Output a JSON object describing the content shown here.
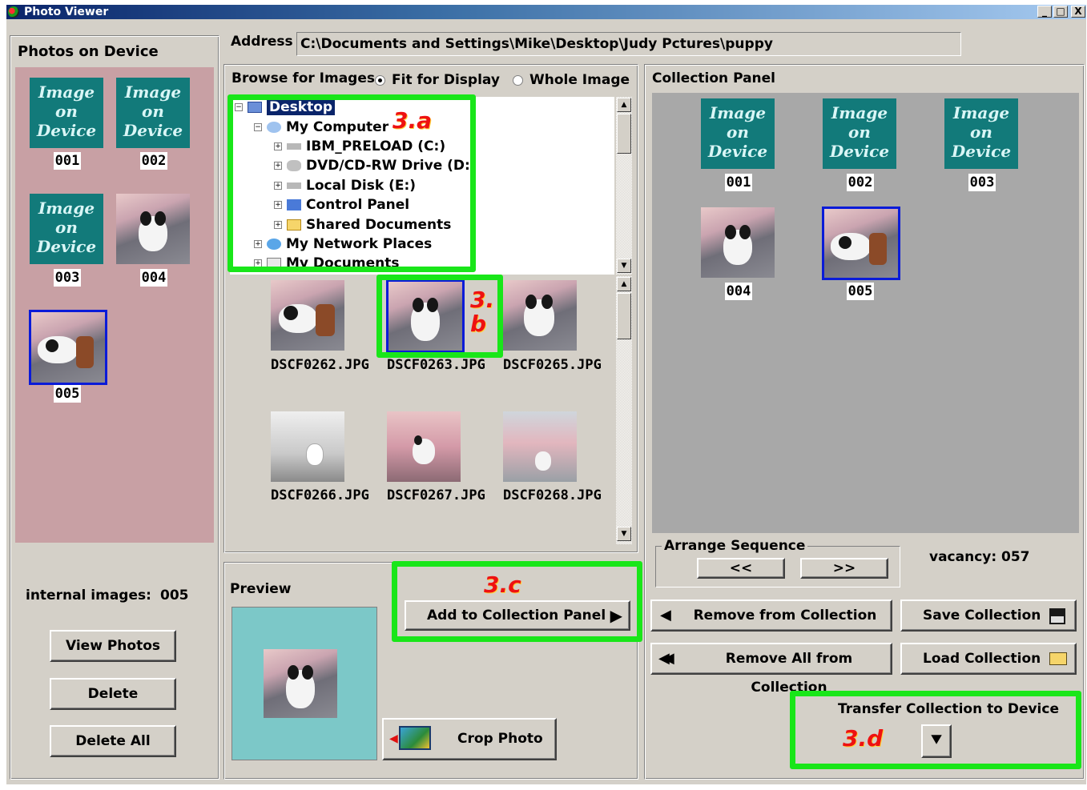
{
  "window": {
    "title": "Photo Viewer",
    "controls": [
      "_",
      "□",
      "X"
    ]
  },
  "device_panel": {
    "title": "Photos on Device",
    "placeholder_lines": [
      "Image",
      "on",
      "Device"
    ],
    "items": [
      {
        "number": "001",
        "type": "placeholder"
      },
      {
        "number": "002",
        "type": "placeholder"
      },
      {
        "number": "003",
        "type": "placeholder"
      },
      {
        "number": "004",
        "type": "photo"
      },
      {
        "number": "005",
        "type": "photo",
        "selected": true
      }
    ],
    "internal_label": "internal images:",
    "internal_count": "005",
    "buttons": {
      "view": "View Photos",
      "delete": "Delete",
      "delete_all": "Delete All"
    }
  },
  "address": {
    "label": "Address",
    "value": "C:\\Documents and Settings\\Mike\\Desktop\\Judy Pctures\\puppy"
  },
  "browse": {
    "label": "Browse for Images",
    "options": [
      {
        "label": "Fit for Display",
        "checked": true
      },
      {
        "label": "Whole Image",
        "checked": false
      }
    ],
    "tree": [
      {
        "label": "Desktop",
        "icon": "desktop-icon",
        "selected": true
      },
      {
        "label": "My Computer",
        "icon": "computer-icon"
      },
      {
        "label": "IBM_PRELOAD (C:)",
        "icon": "drive-icon"
      },
      {
        "label": "DVD/CD-RW Drive (D:)",
        "icon": "cd-drive-icon"
      },
      {
        "label": "Local Disk (E:)",
        "icon": "drive-icon"
      },
      {
        "label": "Control Panel",
        "icon": "control-panel-icon"
      },
      {
        "label": "Shared Documents",
        "icon": "folder-icon"
      },
      {
        "label": "My Network Places",
        "icon": "network-icon"
      },
      {
        "label": "My Documents",
        "icon": "documents-icon"
      }
    ],
    "files": [
      "DSCF0262.JPG",
      "DSCF0263.JPG",
      "DSCF0265.JPG",
      "DSCF0266.JPG",
      "DSCF0267.JPG",
      "DSCF0268.JPG"
    ],
    "selected_file": "DSCF0263.JPG"
  },
  "annotations": {
    "a": "3.a",
    "b1": "3.",
    "b2": "b",
    "c": "3.c",
    "d": "3.d"
  },
  "preview": {
    "label": "Preview"
  },
  "add_button": "Add to Collection Panel",
  "crop_button": "Crop Photo",
  "collection": {
    "title": "Collection Panel",
    "placeholder_lines": [
      "Image",
      "on",
      "Device"
    ],
    "items": [
      {
        "number": "001",
        "type": "placeholder"
      },
      {
        "number": "002",
        "type": "placeholder"
      },
      {
        "number": "003",
        "type": "placeholder"
      },
      {
        "number": "004",
        "type": "photo"
      },
      {
        "number": "005",
        "type": "photo",
        "selected": true
      }
    ],
    "arrange_label": "Arrange Sequence",
    "arrange_prev": "<<",
    "arrange_next": ">>",
    "vacancy_label": "vacancy:",
    "vacancy_value": "057",
    "remove": "Remove from Collection",
    "remove_all": "Remove All from Collection",
    "save": "Save Collection",
    "load": "Load Collection",
    "transfer": "Transfer Collection to Device"
  },
  "colors": {
    "highlight_green": "#19e619",
    "annotation_red": "#ee1111",
    "device_bg": "#c8a0a4",
    "placeholder_teal": "#127a7a",
    "selection_blue": "#0a1bd8"
  }
}
